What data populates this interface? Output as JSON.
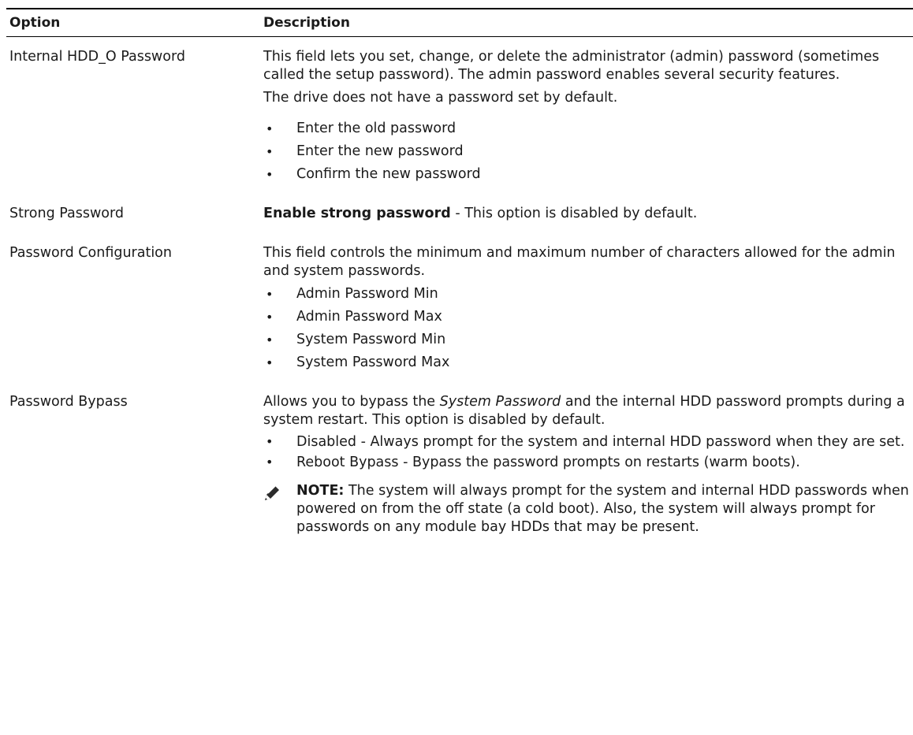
{
  "table": {
    "header": {
      "option": "Option",
      "description": "Description"
    },
    "rows": [
      {
        "option": "Internal HDD_O Password",
        "paragraphs": [
          "This field lets you set, change, or delete the administrator (admin) password (sometimes called the setup password). The admin password enables several security features.",
          "The drive does not have a password set by default."
        ],
        "bullets": [
          "Enter the old password",
          "Enter the new password",
          "Confirm the new password"
        ]
      },
      {
        "option": "Strong Password",
        "bold_lead": "Enable strong password",
        "rest": " - This option is disabled by default."
      },
      {
        "option": "Password Configuration",
        "paragraphs": [
          "This field controls the minimum and maximum number of characters allowed for the admin and system passwords."
        ],
        "bullets": [
          "Admin Password Min",
          "Admin Password Max",
          "System Password Min",
          "System Password Max"
        ]
      },
      {
        "option": "Password Bypass",
        "intro_pre": "Allows you to bypass the ",
        "intro_em": "System Password",
        "intro_post": " and the internal HDD password prompts during a system restart. This option is disabled by default.",
        "bullets": [
          "Disabled - Always prompt for the system and internal HDD password when they are set.",
          "Reboot Bypass - Bypass the password prompts on restarts (warm boots)."
        ],
        "note": {
          "label": "NOTE:",
          "text": " The system will always prompt for the system and internal HDD passwords when powered on from the off state (a cold boot). Also, the system will always prompt for passwords on any module bay HDDs that may be present.",
          "icon": "pencil-icon"
        }
      }
    ],
    "bullet_glyph": "•"
  }
}
